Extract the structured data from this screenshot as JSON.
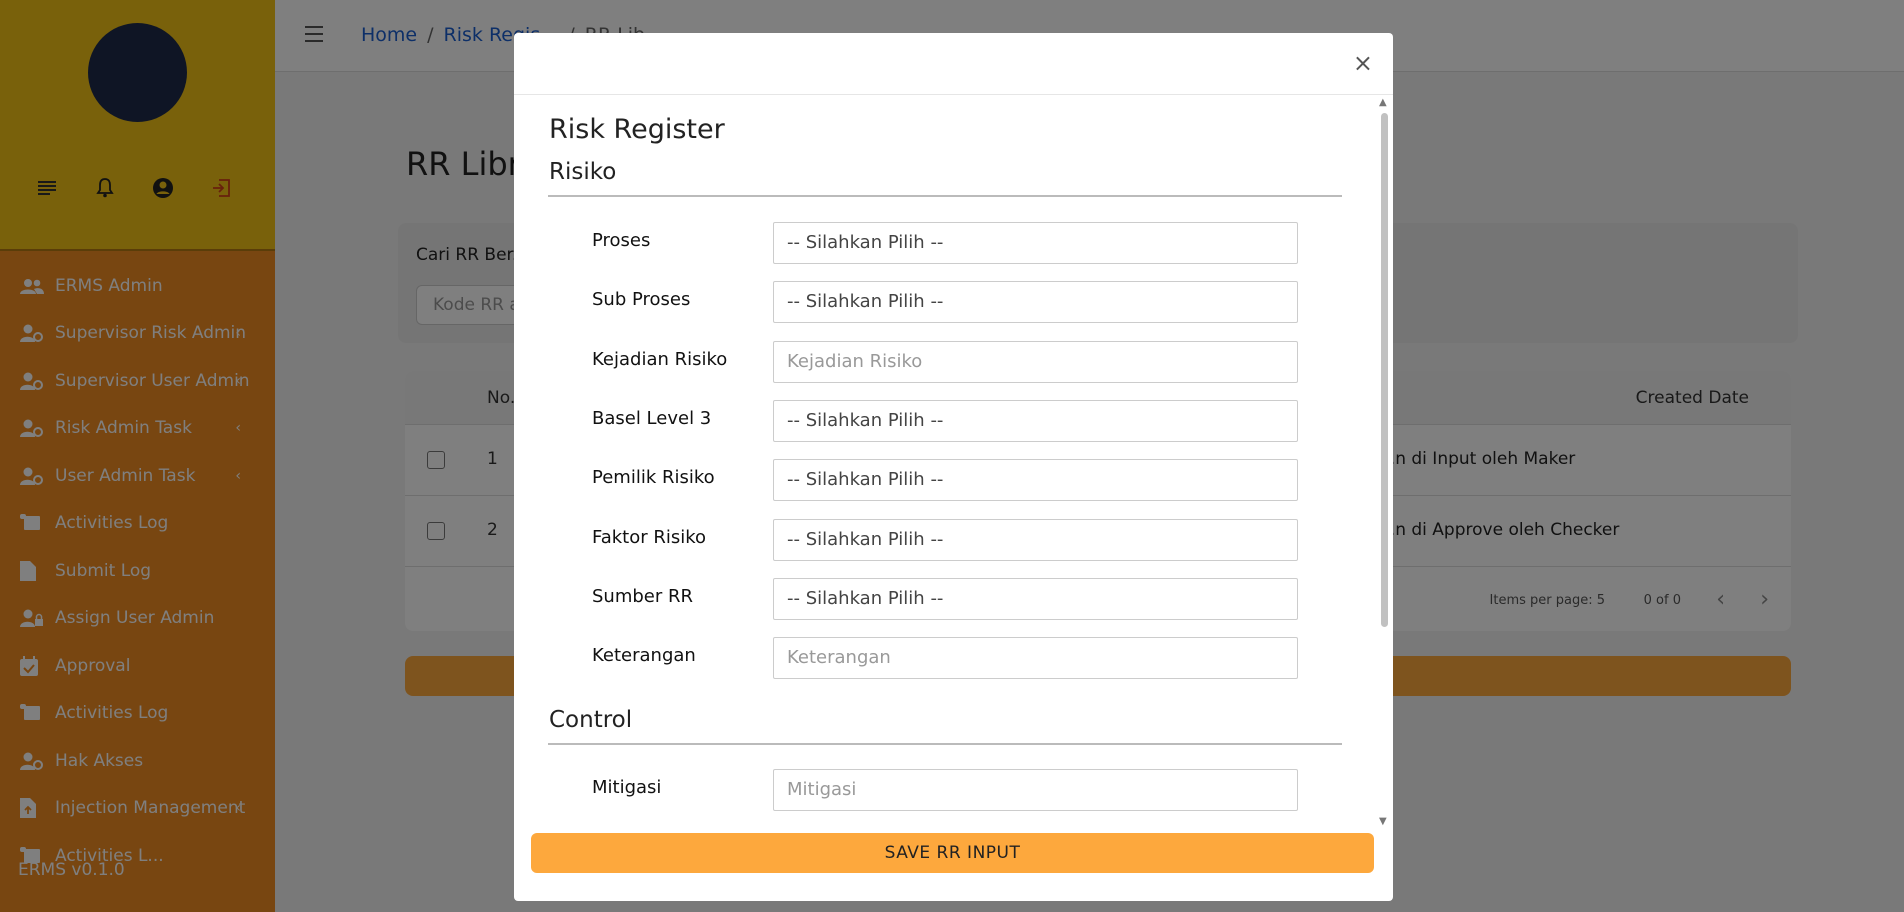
{
  "sidebar": {
    "items": [
      {
        "label": "ERMS Admin",
        "icon": "users-icon",
        "chevron": ""
      },
      {
        "label": "Supervisor Risk Admin",
        "icon": "user-gear-icon",
        "chevron": "‹"
      },
      {
        "label": "Supervisor User Admin",
        "icon": "user-gear-icon",
        "chevron": "‹"
      },
      {
        "label": "Risk Admin Task",
        "icon": "user-gear-icon",
        "chevron": "‹"
      },
      {
        "label": "User Admin Task",
        "icon": "user-gear-icon",
        "chevron": "‹"
      },
      {
        "label": "Activities Log",
        "icon": "scroll-icon",
        "chevron": ""
      },
      {
        "label": "Submit Log",
        "icon": "file-icon",
        "chevron": ""
      },
      {
        "label": "Assign User Admin",
        "icon": "user-lock-icon",
        "chevron": ""
      },
      {
        "label": "Approval",
        "icon": "calendar-check-icon",
        "chevron": ""
      },
      {
        "label": "Activities Log",
        "icon": "scroll-icon",
        "chevron": ""
      },
      {
        "label": "Hak Akses",
        "icon": "user-gear-icon",
        "chevron": ""
      },
      {
        "label": "Injection Management",
        "icon": "file-upload-icon",
        "chevron": "‹"
      },
      {
        "label": "Activities L...",
        "icon": "scroll-icon",
        "chevron": ""
      }
    ],
    "version": "ERMS v0.1.0"
  },
  "header": {
    "breadcrumb": [
      "Home",
      "/",
      "Risk Regis...",
      "/",
      "RR Lib..."
    ]
  },
  "main": {
    "title": "RR Libr...",
    "search_label": "Cari RR Ber...",
    "search_placeholder": "Kode RR a...",
    "table": {
      "col_no": "No.",
      "col_created": "Created Date",
      "rows": [
        {
          "no": "1",
          "desc": "...n di Input oleh Maker"
        },
        {
          "no": "2",
          "desc": "...n di Approve oleh Checker"
        }
      ],
      "items_per_page": "Items per page: 5",
      "range": "0 of 0"
    }
  },
  "modal": {
    "title": "Risk Register",
    "close": "×",
    "section_risiko": "Risiko",
    "section_control": "Control",
    "fields": [
      {
        "label": "Proses",
        "value": "-- Silahkan Pilih --",
        "kind": "select"
      },
      {
        "label": "Sub Proses",
        "value": "-- Silahkan Pilih --",
        "kind": "select"
      },
      {
        "label": "Kejadian Risiko",
        "value": "Kejadian Risiko",
        "kind": "input"
      },
      {
        "label": "Basel Level 3",
        "value": "-- Silahkan Pilih --",
        "kind": "select"
      },
      {
        "label": "Pemilik Risiko",
        "value": "-- Silahkan Pilih --",
        "kind": "select"
      },
      {
        "label": "Faktor Risiko",
        "value": "-- Silahkan Pilih --",
        "kind": "select"
      },
      {
        "label": "Sumber RR",
        "value": "-- Silahkan Pilih --",
        "kind": "select"
      },
      {
        "label": "Keterangan",
        "value": "Keterangan",
        "kind": "input"
      }
    ],
    "control_fields": [
      {
        "label": "Mitigasi",
        "value": "Mitigasi",
        "kind": "input"
      }
    ],
    "save_label": "SAVE RR INPUT"
  }
}
